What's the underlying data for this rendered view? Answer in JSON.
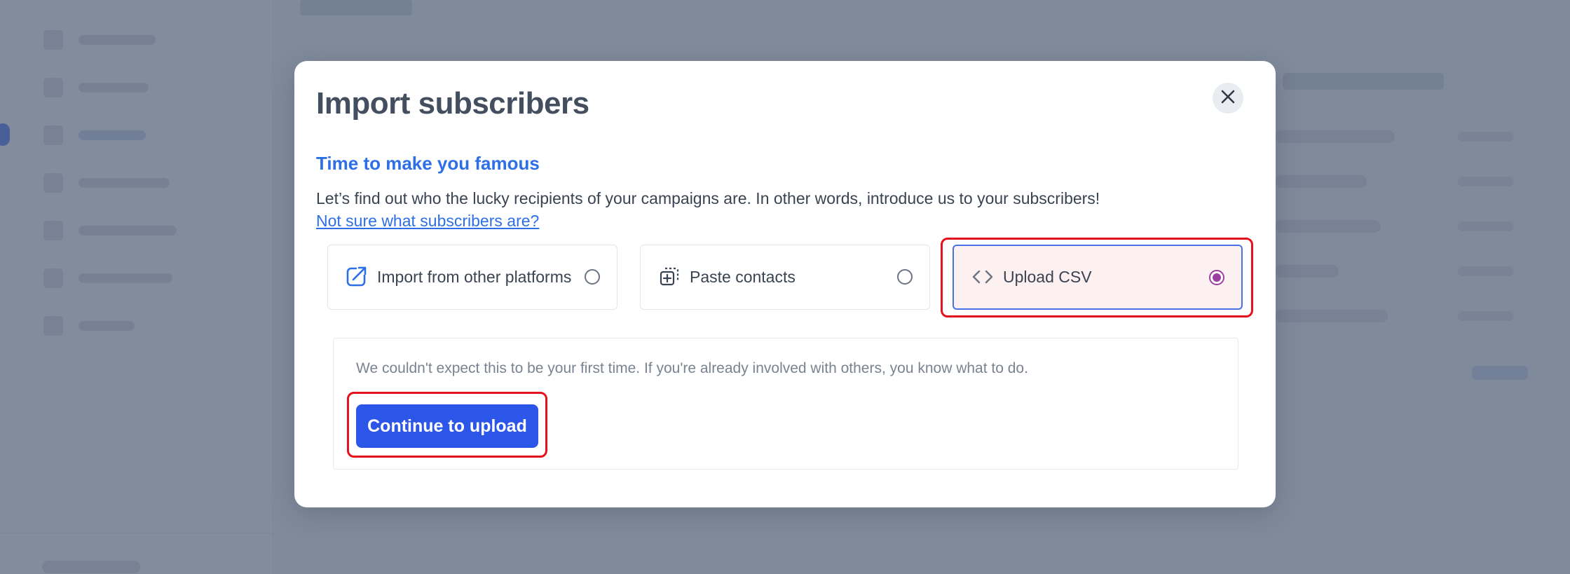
{
  "modal": {
    "title": "Import subscribers",
    "section_title": "Time to make you famous",
    "intro_text": "Let’s find out who the lucky recipients of your campaigns are. In other words, introduce us to your subscribers!",
    "help_link": "Not sure what subscribers are?",
    "options": [
      {
        "label": "Import from other platforms",
        "icon": "external-import-icon",
        "selected": false
      },
      {
        "label": "Paste contacts",
        "icon": "paste-icon",
        "selected": false
      },
      {
        "label": "Upload CSV",
        "icon": "code-icon",
        "selected": true
      }
    ],
    "info_text": "We couldn't expect this to be your first time. If you're already involved with others, you know what to do.",
    "continue_label": "Continue to upload",
    "close_icon": "close-icon"
  },
  "colors": {
    "accent": "#2b56e8",
    "link": "#2d6fe6",
    "selected_radio": "#9b3fa0",
    "highlight": "#e3121c"
  }
}
